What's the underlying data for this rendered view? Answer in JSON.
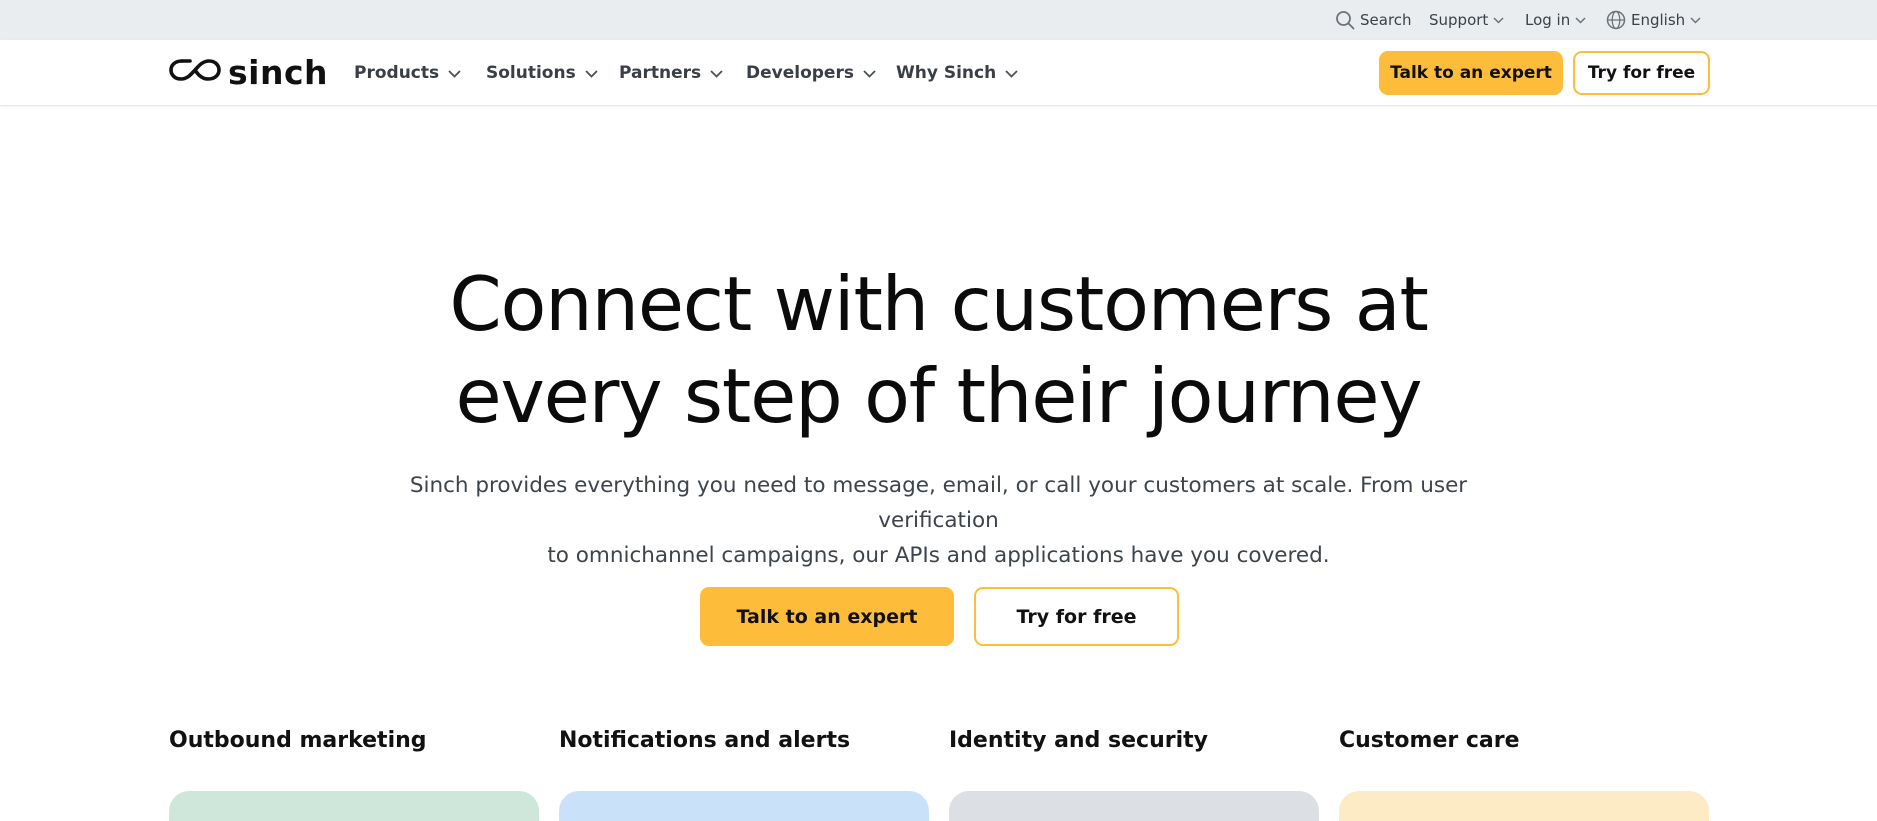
{
  "utility": {
    "search_label": "Search",
    "support_label": "Support",
    "login_label": "Log in",
    "language_label": "English"
  },
  "brand": {
    "logo_text": "sinch",
    "accent_color": "#fdbd3b"
  },
  "nav": {
    "items": [
      {
        "label": "Products"
      },
      {
        "label": "Solutions"
      },
      {
        "label": "Partners"
      },
      {
        "label": "Developers"
      },
      {
        "label": "Why Sinch"
      }
    ],
    "cta_primary": "Talk to an expert",
    "cta_secondary": "Try for free"
  },
  "hero": {
    "title_line1": "Connect with customers at",
    "title_line2": "every step of their journey",
    "subtitle_line1": "Sinch provides everything you need to message, email, or call your customers at scale. From user verification",
    "subtitle_line2": "to omnichannel campaigns, our APIs and applications have you covered.",
    "cta_primary": "Talk to an expert",
    "cta_secondary": "Try for free"
  },
  "categories": [
    {
      "title": "Outbound marketing",
      "color": "#cfe6db"
    },
    {
      "title": "Notifications and alerts",
      "color": "#c9e2f9"
    },
    {
      "title": "Identity and security",
      "color": "#dcdfe3"
    },
    {
      "title": "Customer care",
      "color": "#fcebc4"
    }
  ],
  "icons": {
    "search": "search-icon",
    "chevron": "chevron-down-icon",
    "globe": "globe-icon",
    "logo": "sinch-logo-icon"
  }
}
